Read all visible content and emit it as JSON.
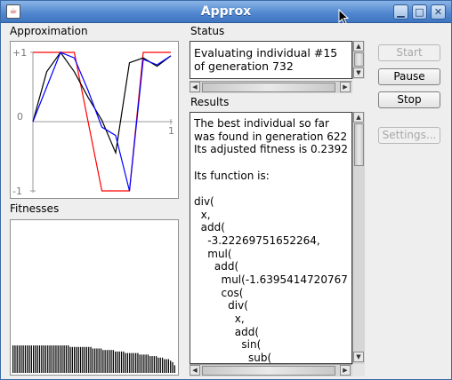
{
  "window": {
    "title": "Approx",
    "buttons": {
      "minimize": "▁",
      "maximize": "□",
      "close": "✕"
    }
  },
  "approximation": {
    "label": "Approximation",
    "y_tick_top": "+1",
    "y_tick_zero": "0",
    "y_tick_bottom": "-1",
    "x_tick_one": "1"
  },
  "fitnesses": {
    "label": "Fitnesses",
    "bars": [
      0.18,
      0.18,
      0.18,
      0.18,
      0.18,
      0.18,
      0.18,
      0.18,
      0.18,
      0.18,
      0.18,
      0.18,
      0.18,
      0.18,
      0.18,
      0.18,
      0.18,
      0.18,
      0.18,
      0.18,
      0.18,
      0.18,
      0.18,
      0.18,
      0.18,
      0.18,
      0.18,
      0.18,
      0.17,
      0.17,
      0.17,
      0.17,
      0.17,
      0.17,
      0.17,
      0.17,
      0.17,
      0.17,
      0.17,
      0.16,
      0.16,
      0.16,
      0.16,
      0.16,
      0.15,
      0.15,
      0.15,
      0.15,
      0.15,
      0.15,
      0.14,
      0.14,
      0.14,
      0.14,
      0.14,
      0.13,
      0.13,
      0.13,
      0.13,
      0.13,
      0.13,
      0.13,
      0.12,
      0.12,
      0.12,
      0.12,
      0.12,
      0.11,
      0.11,
      0.11,
      0.11,
      0.1,
      0.1,
      0.1,
      0.09,
      0.09,
      0.09,
      0.08,
      0.07,
      0.05
    ]
  },
  "status": {
    "label": "Status",
    "text": "Evaluating individual #15\nof generation 732"
  },
  "results": {
    "label": "Results",
    "text": "The best individual so far\nwas found in generation 622\nIts adjusted fitness is 0.2392\n\nIts function is:\n\ndiv(\n  x,\n  add(\n    -3.22269751652264,\n    mul(\n      add(\n        mul(-1.6395414720767\n        cos(\n          div(\n            x,\n            add(\n              sin(\n                sub(\n                  exp("
  },
  "controls": {
    "start": "Start",
    "pause": "Pause",
    "stop": "Stop",
    "settings": "Settings..."
  },
  "chart_data": {
    "type": "line",
    "x": [
      0,
      0.1,
      0.2,
      0.3,
      0.4,
      0.5,
      0.6,
      0.7,
      0.8,
      0.9,
      1
    ],
    "ylim": [
      -1,
      1
    ],
    "xlim": [
      0,
      1
    ],
    "series": [
      {
        "color": "#ff0000",
        "values": [
          1,
          1,
          1,
          1,
          0,
          -1,
          -1,
          -1,
          1,
          1,
          1
        ]
      },
      {
        "color": "#0000ff",
        "values": [
          0,
          0.5,
          1,
          0.92,
          0.45,
          -0.08,
          -0.2,
          -1,
          0.9,
          0.82,
          0.95
        ]
      },
      {
        "color": "#000000",
        "values": [
          0,
          0.72,
          1,
          0.72,
          0.35,
          0.02,
          -0.45,
          0.85,
          0.92,
          0.8,
          0.95
        ]
      }
    ]
  },
  "colors": {
    "accent": "#4f86cf",
    "fitness_bar": "#000000"
  }
}
